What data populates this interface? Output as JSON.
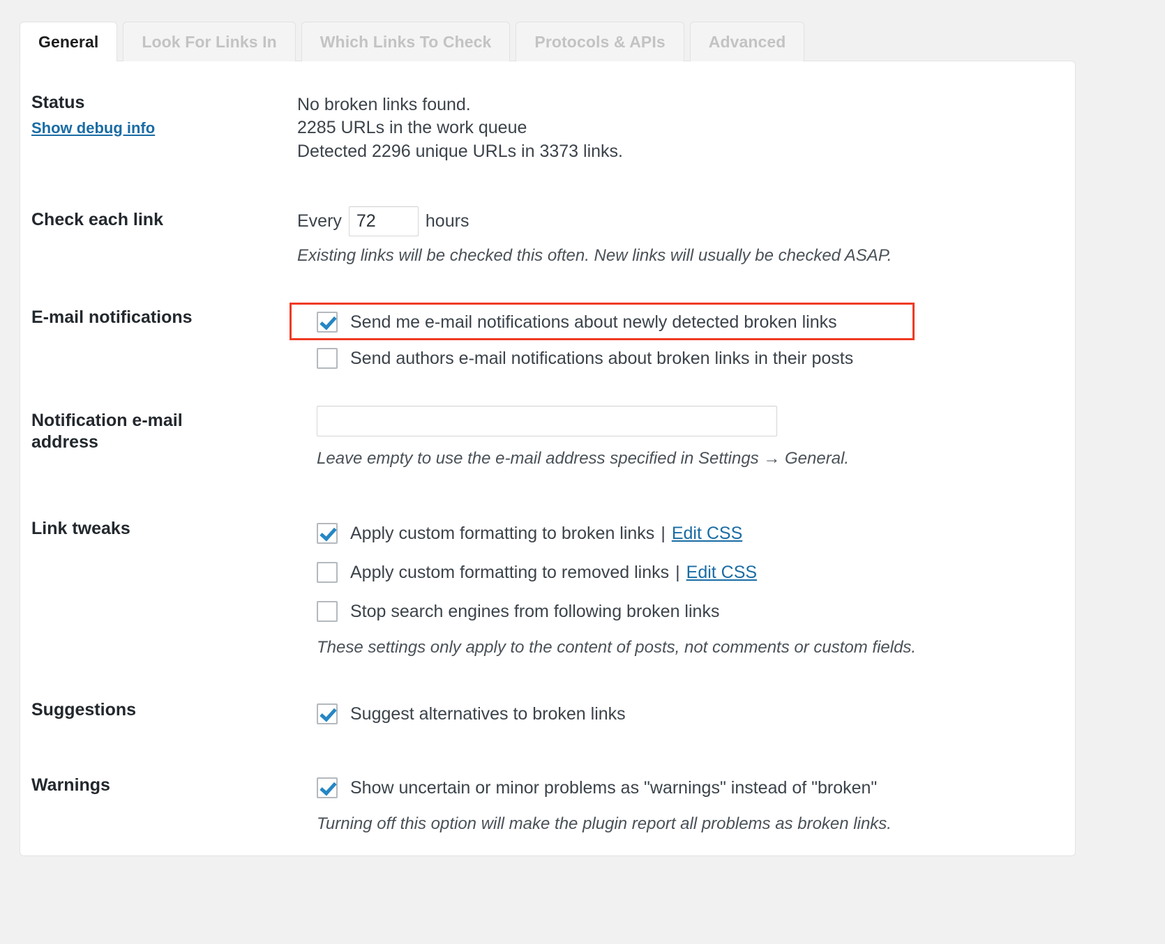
{
  "tabs": [
    {
      "label": "General",
      "active": true
    },
    {
      "label": "Look For Links In",
      "active": false
    },
    {
      "label": "Which Links To Check",
      "active": false
    },
    {
      "label": "Protocols & APIs",
      "active": false
    },
    {
      "label": "Advanced",
      "active": false
    }
  ],
  "colors": {
    "page_background": "#f1f1f1",
    "panel_background": "#ffffff",
    "link": "#1a6ca4",
    "checkbox_check": "#2586c4",
    "highlight_border": "#ef3b23",
    "tab_inactive_text": "#c3c3c3"
  },
  "sections": {
    "status": {
      "label": "Status",
      "debug_link": "Show debug info",
      "lines": [
        "No broken links found.",
        "2285 URLs in the work queue",
        "Detected 2296 unique URLs in 3373 links."
      ]
    },
    "check_each_link": {
      "label": "Check each link",
      "prefix": "Every",
      "value": "72",
      "suffix": "hours",
      "hint": "Existing links will be checked this often. New links will usually be checked ASAP."
    },
    "email_notifications": {
      "label": "E-mail notifications",
      "options": [
        {
          "label": "Send me e-mail notifications about newly detected broken links",
          "checked": true,
          "highlighted": true
        },
        {
          "label": "Send authors e-mail notifications about broken links in their posts",
          "checked": false,
          "highlighted": false
        }
      ]
    },
    "notification_email": {
      "label": "Notification e-mail address",
      "value": "",
      "placeholder": "",
      "hint": "Leave empty to use the e-mail address specified in Settings → General."
    },
    "link_tweaks": {
      "label": "Link tweaks",
      "options": [
        {
          "label": "Apply custom formatting to broken links",
          "checked": true,
          "separator": "|",
          "link": "Edit CSS"
        },
        {
          "label": "Apply custom formatting to removed links",
          "checked": false,
          "separator": "|",
          "link": "Edit CSS"
        },
        {
          "label": "Stop search engines from following broken links",
          "checked": false,
          "separator": "",
          "link": ""
        }
      ],
      "hint": "These settings only apply to the content of posts, not comments or custom fields."
    },
    "suggestions": {
      "label": "Suggestions",
      "option": {
        "label": "Suggest alternatives to broken links",
        "checked": true
      }
    },
    "warnings": {
      "label": "Warnings",
      "option": {
        "label": "Show uncertain or minor problems as \"warnings\" instead of \"broken\"",
        "checked": true
      },
      "hint": "Turning off this option will make the plugin report all problems as broken links."
    }
  }
}
